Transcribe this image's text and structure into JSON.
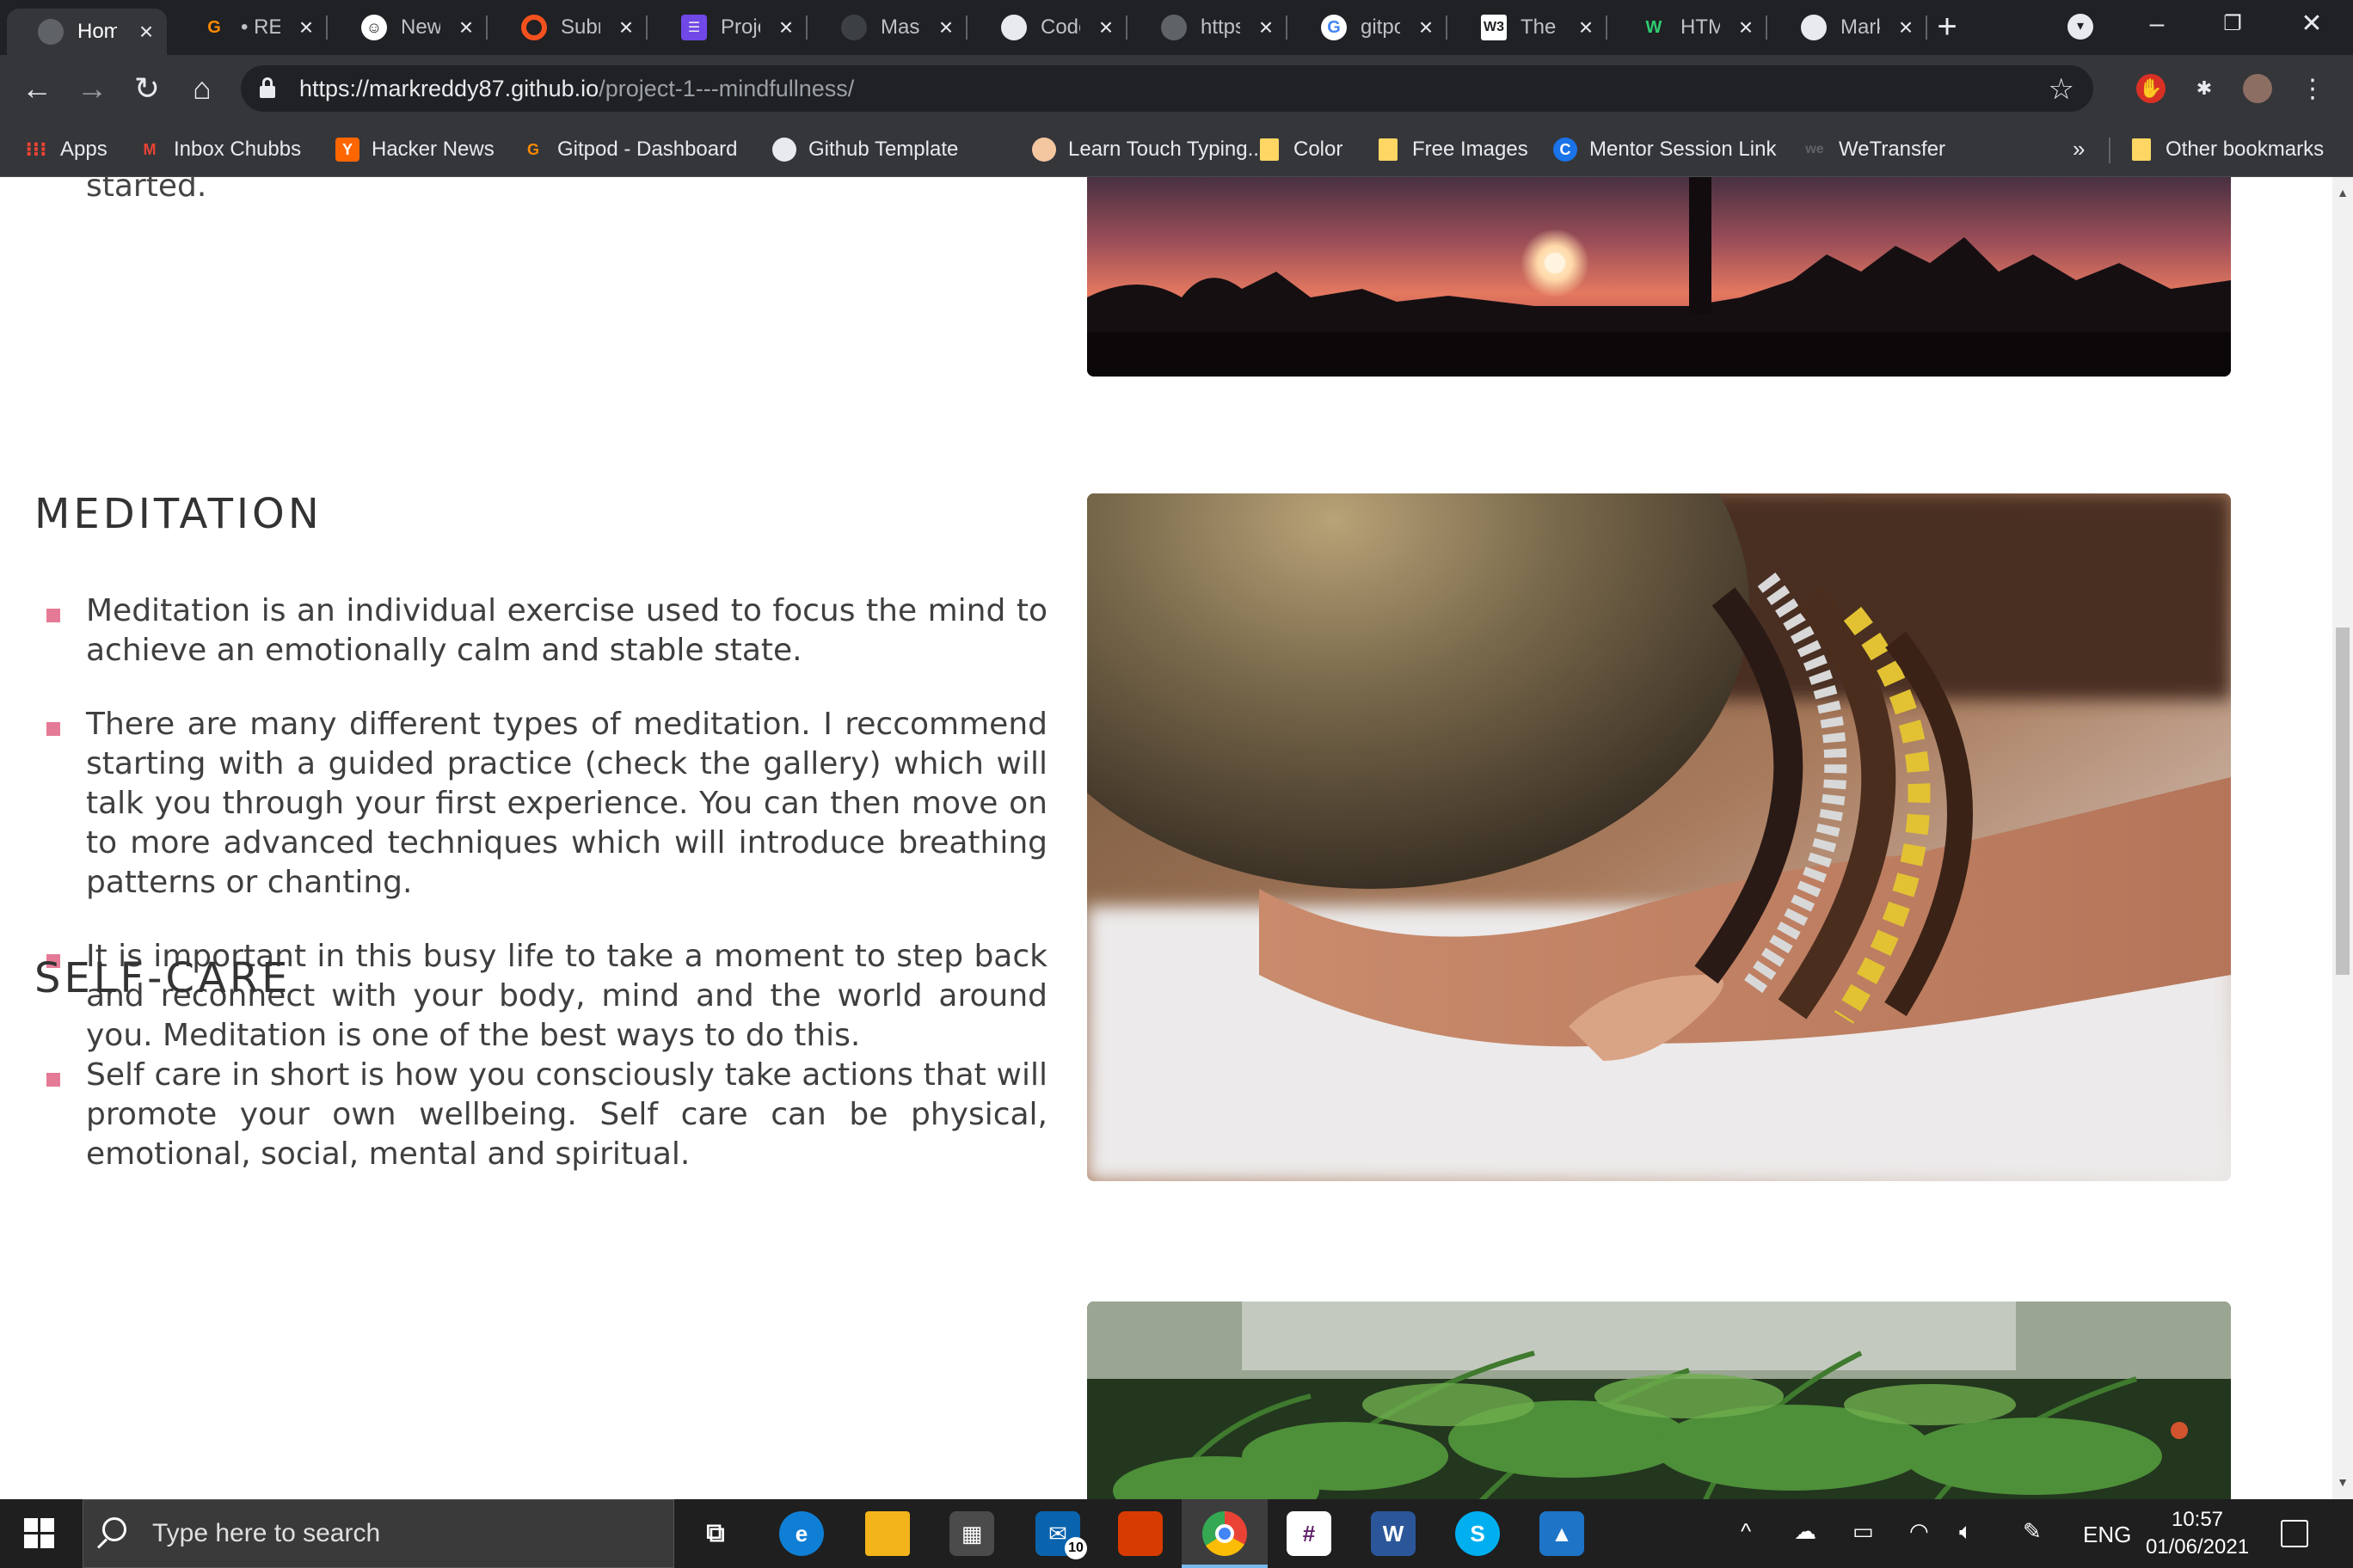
{
  "browser": {
    "tabs": [
      {
        "title": "Home",
        "icon": "globe-icon",
        "active": true
      },
      {
        "title": "• REA",
        "icon": "gitpod-icon"
      },
      {
        "title": "New",
        "icon": "smiley-icon"
      },
      {
        "title": "Subm",
        "icon": "orange-circle-icon"
      },
      {
        "title": "Proje",
        "icon": "project-board-icon"
      },
      {
        "title": "Mast",
        "icon": "github-icon"
      },
      {
        "title": "Code",
        "icon": "github-icon"
      },
      {
        "title": "https",
        "icon": "globe-icon"
      },
      {
        "title": "gitpo",
        "icon": "google-icon"
      },
      {
        "title": "The V",
        "icon": "w3schools-icon"
      },
      {
        "title": "HTM",
        "icon": "w-icon"
      },
      {
        "title": "Mark",
        "icon": "github-icon"
      }
    ],
    "url_host": "https://markreddy87.github.io",
    "url_path": "/project-1---mindfullness/",
    "bookmarks": [
      {
        "label": "Apps",
        "icon": "apps-grid-icon"
      },
      {
        "label": "Inbox Chubbs",
        "icon": "gmail-icon"
      },
      {
        "label": "Hacker News",
        "icon": "y-icon"
      },
      {
        "label": "Gitpod - Dashboard",
        "icon": "gitpod-icon"
      },
      {
        "label": "Github Template",
        "icon": "github-icon"
      },
      {
        "label": "Learn Touch Typing...",
        "icon": "ninja-icon"
      },
      {
        "label": "Color",
        "icon": "folder-icon"
      },
      {
        "label": "Free Images",
        "icon": "folder-icon"
      },
      {
        "label": "Mentor Session Link",
        "icon": "circle-c-icon"
      },
      {
        "label": "WeTransfer",
        "icon": "we-icon"
      }
    ],
    "bookmarks_more": "»",
    "other_bookmarks": "Other bookmarks"
  },
  "page": {
    "intro_tail": "started.",
    "sections": [
      {
        "title": "MEDITATION",
        "bullets": [
          "Meditation is an individual exercise used to focus the mind to achieve an emotionally calm and stable state.",
          "There are many different types of meditation. I reccommend starting with a guided practice (check the gallery) which will talk you through your first experience. You can then move on to more advanced techniques which will introduce breathing patterns or chanting.",
          "It is important in this busy life to take a moment to step back and reconnect with your body, mind and the world around you. Meditation is one of the best ways to do this."
        ]
      },
      {
        "title": "SELF-CARE",
        "bullets": [
          "Self care in short is how you consciously take actions that will promote your own wellbeing. Self care can be physical, emotional, social, mental and spiritual."
        ]
      }
    ],
    "accent_color": "#e57a96"
  },
  "taskbar": {
    "search_placeholder": "Type here to search",
    "mail_badge": "10",
    "language": "ENG",
    "time": "10:57",
    "date": "01/06/2021"
  }
}
